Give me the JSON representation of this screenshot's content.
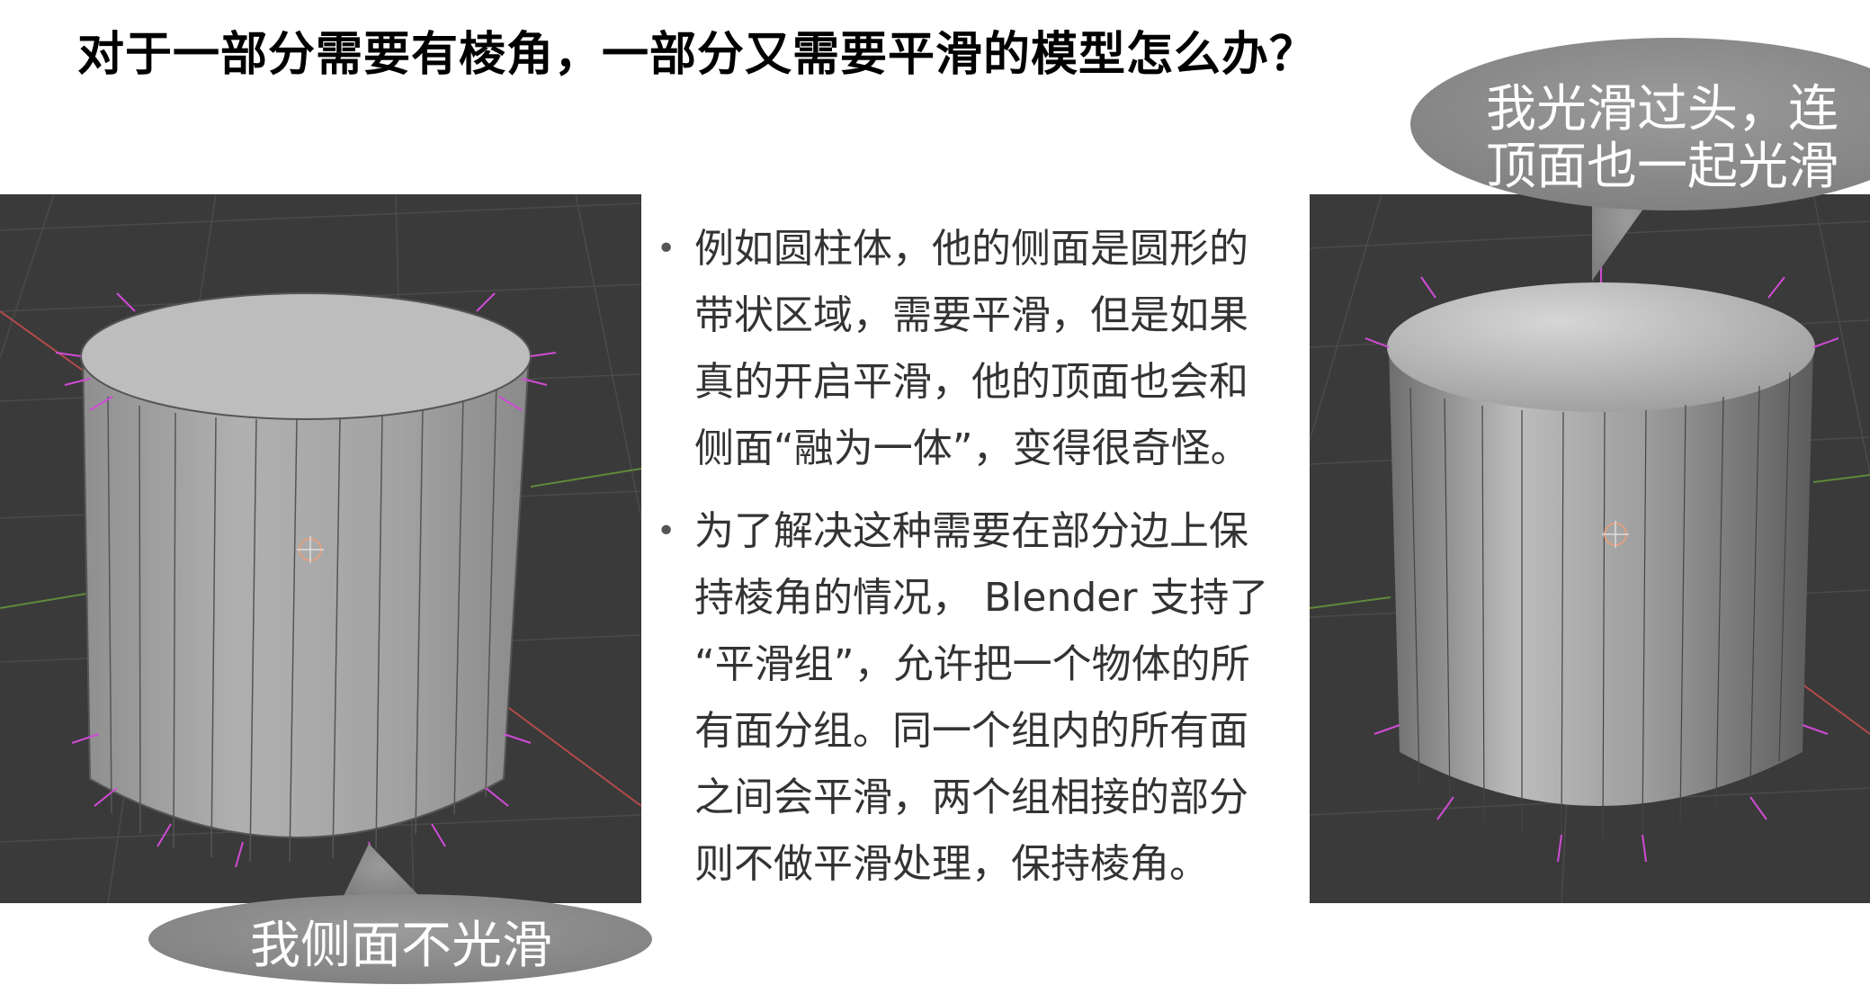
{
  "title": "对于一部分需要有棱角，一部分又需要平滑的模型怎么办？",
  "bullets": [
    {
      "lines": [
        "例如圆柱体，他的侧面是圆形的",
        "带状区域，需要平滑，但是如果",
        "真的开启平滑，他的顶面也会和",
        "侧面“融为一体”，变得很奇怪。"
      ]
    },
    {
      "lines": [
        "为了解决这种需要在部分边上保",
        "持棱角的情况， Blender 支持了",
        "“平滑组”，允许把一个物体的所",
        "有面分组。同一个组内的所有面",
        "之间会平滑，两个组相接的部分",
        "则不做平滑处理，保持棱角。"
      ]
    }
  ],
  "bubbles": {
    "left": "我侧面不光滑",
    "right_line1": "我光滑过头，连",
    "right_line2": "顶面也一起光滑"
  },
  "colors": {
    "viewport_bg": "#3a3a3a",
    "cylinder": "#a8a8a8",
    "normals": "#d04bd6",
    "bubble": "#8e8e8e"
  }
}
